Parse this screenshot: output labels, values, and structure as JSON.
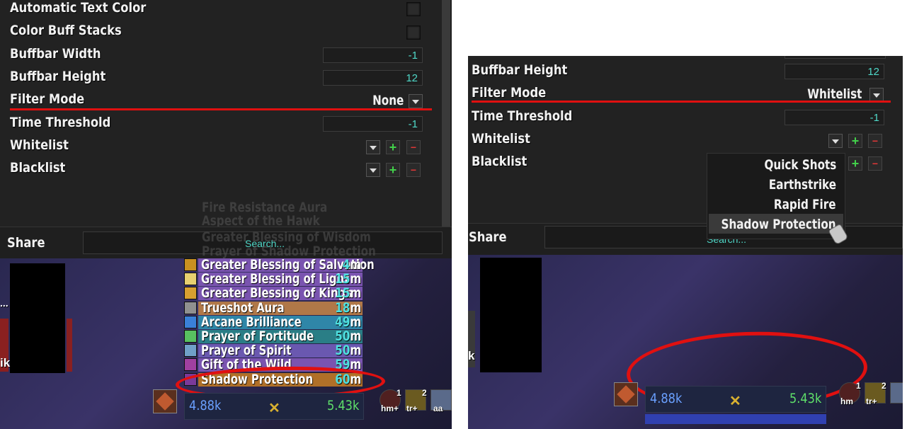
{
  "left": {
    "settings": {
      "automatic_text_color": "Automatic Text Color",
      "color_buff_stacks": "Color Buff Stacks",
      "buffbar_width": "Buffbar Width",
      "buffbar_width_value": "-1",
      "buffbar_height": "Buffbar Height",
      "buffbar_height_value": "12",
      "filter_mode": "Filter Mode",
      "filter_mode_value": "None",
      "time_threshold": "Time Threshold",
      "time_threshold_value": "-1",
      "whitelist": "Whitelist",
      "blacklist": "Blacklist"
    },
    "share": {
      "label": "Share",
      "search": "Search..."
    },
    "ghost_lines": [
      "Fire Resistance Aura",
      "Aspect of the Hawk",
      "Greater Blessing of Wisdom",
      "Prayer of Shadow Protection"
    ],
    "buffs": [
      {
        "name": "Greater Blessing of Salvation",
        "time": "4",
        "unit": "m",
        "color": "#7a54b0",
        "icon": "#c89020"
      },
      {
        "name": "Greater Blessing of Light",
        "time": "15",
        "unit": "m",
        "color": "#7a54b0",
        "icon": "#e8d070"
      },
      {
        "name": "Greater Blessing of Kings",
        "time": "15",
        "unit": "m",
        "color": "#7a54b0",
        "icon": "#d8a030"
      },
      {
        "name": "Trueshot Aura",
        "time": "18",
        "unit": "m",
        "color": "#b07848",
        "icon": "#909090"
      },
      {
        "name": "Arcane Brilliance",
        "time": "49",
        "unit": "m",
        "color": "#2f86a8",
        "icon": "#3a80d8"
      },
      {
        "name": "Prayer of Fortitude",
        "time": "50",
        "unit": "m",
        "color": "#2a7e86",
        "icon": "#58c060"
      },
      {
        "name": "Prayer of Spirit",
        "time": "50",
        "unit": "m",
        "color": "#6a58b0",
        "icon": "#70a0c8"
      },
      {
        "name": "Gift of the Wild",
        "time": "59",
        "unit": "m",
        "color": "#7a54b0",
        "icon": "#a040a0"
      },
      {
        "name": "Shadow Protection",
        "time": "60",
        "unit": "m",
        "color": "#b07028",
        "icon": "#7a3a9a"
      }
    ],
    "unit_left": "4.88k",
    "unit_right": "5.43k",
    "side_labels": [
      "ik",
      "..."
    ],
    "tags": {
      "hm": "hm+",
      "tr": "tr+",
      "aa": "aa",
      "one": "1",
      "two": "2"
    }
  },
  "right": {
    "settings": {
      "buffbar_height": "Buffbar Height",
      "buffbar_height_value": "12",
      "filter_mode": "Filter Mode",
      "filter_mode_value": "Whitelist",
      "time_threshold": "Time Threshold",
      "time_threshold_value": "-1",
      "whitelist": "Whitelist",
      "blacklist": "Blacklist"
    },
    "popup": [
      "Quick Shots",
      "Earthstrike",
      "Rapid Fire",
      "Shadow Protection"
    ],
    "share": {
      "label": "Share",
      "search": "Search..."
    },
    "unit_left": "4.88k",
    "unit_right": "5.43k",
    "side_label": "k",
    "tags": {
      "hm": "hm",
      "tr": "tr+",
      "one": "1",
      "two": "2"
    }
  },
  "colors": {
    "annotation_red": "#e01010",
    "accent_cyan": "#4fd8c8"
  }
}
